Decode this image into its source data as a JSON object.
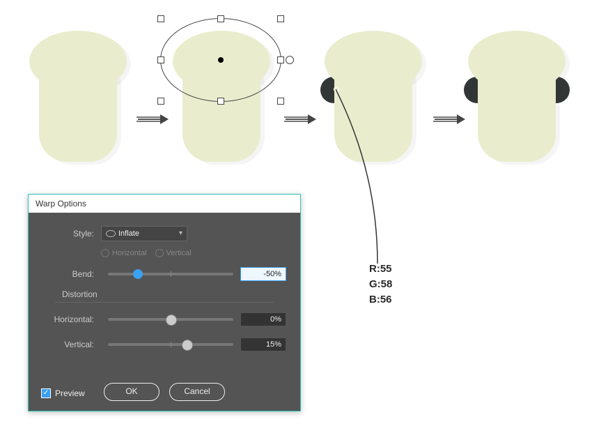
{
  "rgb_label": {
    "r": "R:55",
    "g": "G:58",
    "b": "B:56"
  },
  "panel": {
    "title": "Warp Options",
    "style_label": "Style:",
    "style_value": "Inflate",
    "horiz": "Horizontal",
    "vert": "Vertical",
    "bend_label": "Bend:",
    "bend_value": "-50%",
    "distortion": "Distortion",
    "hd_label": "Horizontal:",
    "hd_value": "0%",
    "vd_label": "Vertical:",
    "vd_value": "15%",
    "preview": "Preview",
    "ok": "OK",
    "cancel": "Cancel"
  }
}
